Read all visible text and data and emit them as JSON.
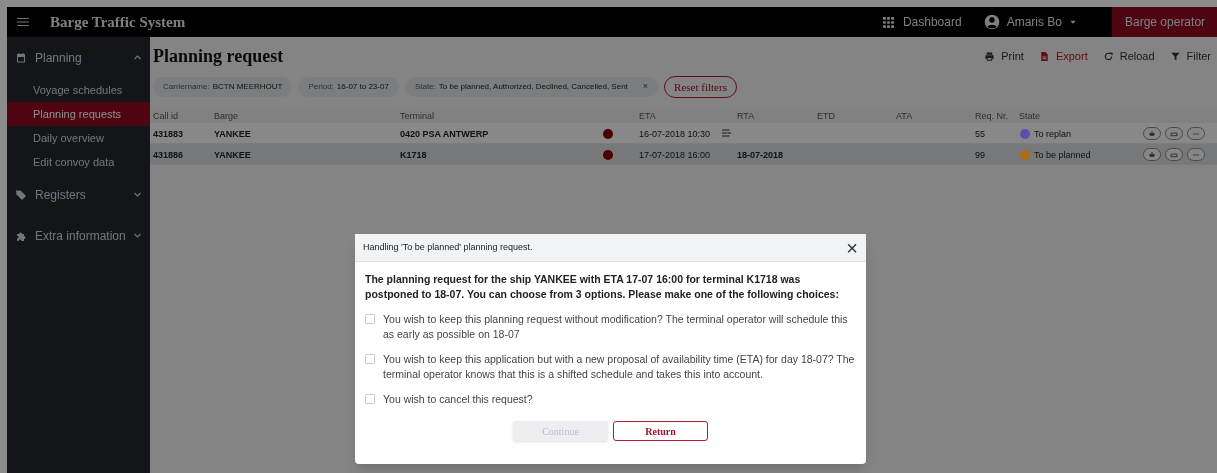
{
  "header": {
    "title": "Barge Traffic System",
    "dashboard": "Dashboard",
    "user": "Amaris Bo",
    "role": "Barge operator"
  },
  "sidebar": {
    "items": [
      {
        "label": "Planning",
        "expanded": true,
        "children": [
          {
            "label": "Voyage schedules",
            "selected": false
          },
          {
            "label": "Planning requests",
            "selected": true
          },
          {
            "label": "Daily overview",
            "selected": false
          },
          {
            "label": "Edit convoy data",
            "selected": false
          }
        ]
      },
      {
        "label": "Registers",
        "expanded": false
      },
      {
        "label": "Extra information",
        "expanded": false
      }
    ]
  },
  "page": {
    "title": "Planning request",
    "toolbar": [
      {
        "label": "Print",
        "kind": "plain"
      },
      {
        "label": "Export",
        "kind": "accent"
      },
      {
        "label": "Reload",
        "kind": "plain"
      },
      {
        "label": "Filter",
        "kind": "plain"
      }
    ],
    "filters": [
      {
        "name": "Carriername:",
        "value": "BCTN MEERHOUT"
      },
      {
        "name": "Period:",
        "value": "16-07 to 23-07"
      },
      {
        "name": "State:",
        "value": "To be planned, Authorized, Declined, Cancelled, Sent",
        "close": "×"
      }
    ],
    "reset": "Reset filters"
  },
  "table": {
    "columns": [
      "Call id",
      "Barge",
      "Terminal",
      "ETA",
      "RTA",
      "ETD",
      "ATA",
      "Req. Nr.",
      "State"
    ],
    "rows": [
      {
        "call_id": "431883",
        "barge": "YANKEE",
        "terminal": "0420 PSA ANTWERP",
        "eta": "16-07-2018 10:30",
        "eta_icon": true,
        "rta": "",
        "req_nr": "55",
        "state": "To replan",
        "color": "#5b4fae",
        "selected": false
      },
      {
        "call_id": "431886",
        "barge": "YANKEE",
        "terminal": "K1718",
        "eta": "17-07-2018 16:00",
        "eta_icon": false,
        "rta": "18-07-2018",
        "req_nr": "99",
        "state": "To be planned",
        "color": "#b06a10",
        "selected": true
      }
    ]
  },
  "dialog": {
    "title": "Handling 'To be planned' planning request.",
    "close": "×",
    "message": "The planning request for the ship YANKEE with ETA 17-07 16:00 for terminal K1718 was postponed to 18-07. You can choose from 3 options. Please make one of the following choices:",
    "options": [
      {
        "label": "You wish to keep this planning request without modification? The terminal operator will schedule this as early as possible on 18-07",
        "checked": false
      },
      {
        "label": "You wish to keep this application but with a new proposal of availability time (ETA) for day 18-07? The terminal operator knows that this is a shifted schedule and takes this into account.",
        "checked": false
      },
      {
        "label": "You wish to cancel this request?",
        "checked": false
      }
    ],
    "buttons": [
      {
        "label": "Continue",
        "disabled": true
      },
      {
        "label": "Return",
        "disabled": false
      }
    ]
  }
}
